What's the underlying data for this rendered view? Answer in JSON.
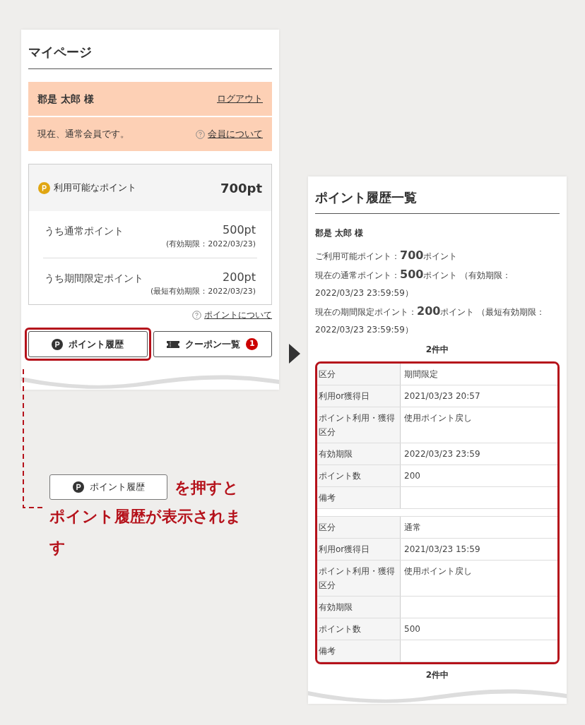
{
  "mypage": {
    "title": "マイページ",
    "member": {
      "name": "郡是 太郎 様",
      "logout": "ログアウト",
      "status": "現在、通常会員です。",
      "about_link": "会員について"
    },
    "points": {
      "available_label": "利用可能なポイント",
      "available_value": "700pt",
      "breakdown": [
        {
          "label": "うち通常ポイント",
          "value": "500pt",
          "expiry": "(有効期限：2022/03/23)"
        },
        {
          "label": "うち期間限定ポイント",
          "value": "200pt",
          "expiry": "(最短有効期限：2022/03/23)"
        }
      ]
    },
    "points_link": "ポイントについて",
    "buttons": [
      {
        "kind": "history",
        "label": "ポイント履歴",
        "highlighted": true
      },
      {
        "kind": "coupon",
        "label": "クーポン一覧",
        "highlighted": false,
        "badge": "1"
      }
    ]
  },
  "annotation": {
    "button_label": "ポイント履歴",
    "text_after": "を押すと",
    "text_below": "ポイント履歴が表示されます"
  },
  "history": {
    "title": "ポイント履歴一覧",
    "name": "郡是 太郎 様",
    "summary": [
      "ご利用可能ポイント：**700**ポイント",
      "現在の通常ポイント：**500**ポイント （有効期限：2022/03/23 23:59:59）",
      "現在の期間限定ポイント：**200**ポイント （最短有効期限：2022/03/23 23:59:59）"
    ],
    "count_top": "2件中",
    "records": [
      {
        "rows": [
          {
            "label": "区分",
            "value": "期間限定"
          },
          {
            "label": "利用or獲得日",
            "value": "2021/03/23 20:57"
          },
          {
            "label": "ポイント利用・獲得区分",
            "value": "使用ポイント戻し"
          },
          {
            "label": "有効期限",
            "value": "2022/03/23 23:59"
          },
          {
            "label": "ポイント数",
            "value": "200"
          },
          {
            "label": "備考"
          }
        ]
      },
      {
        "rows": [
          {
            "label": "区分",
            "value": "通常"
          },
          {
            "label": "利用or獲得日",
            "value": "2021/03/23 15:59"
          },
          {
            "label": "ポイント利用・獲得区分",
            "value": "使用ポイント戻し"
          },
          {
            "label": "有効期限"
          },
          {
            "label": "ポイント数",
            "value": "500"
          },
          {
            "label": "備考"
          }
        ]
      }
    ],
    "count_bottom": "2件中"
  }
}
